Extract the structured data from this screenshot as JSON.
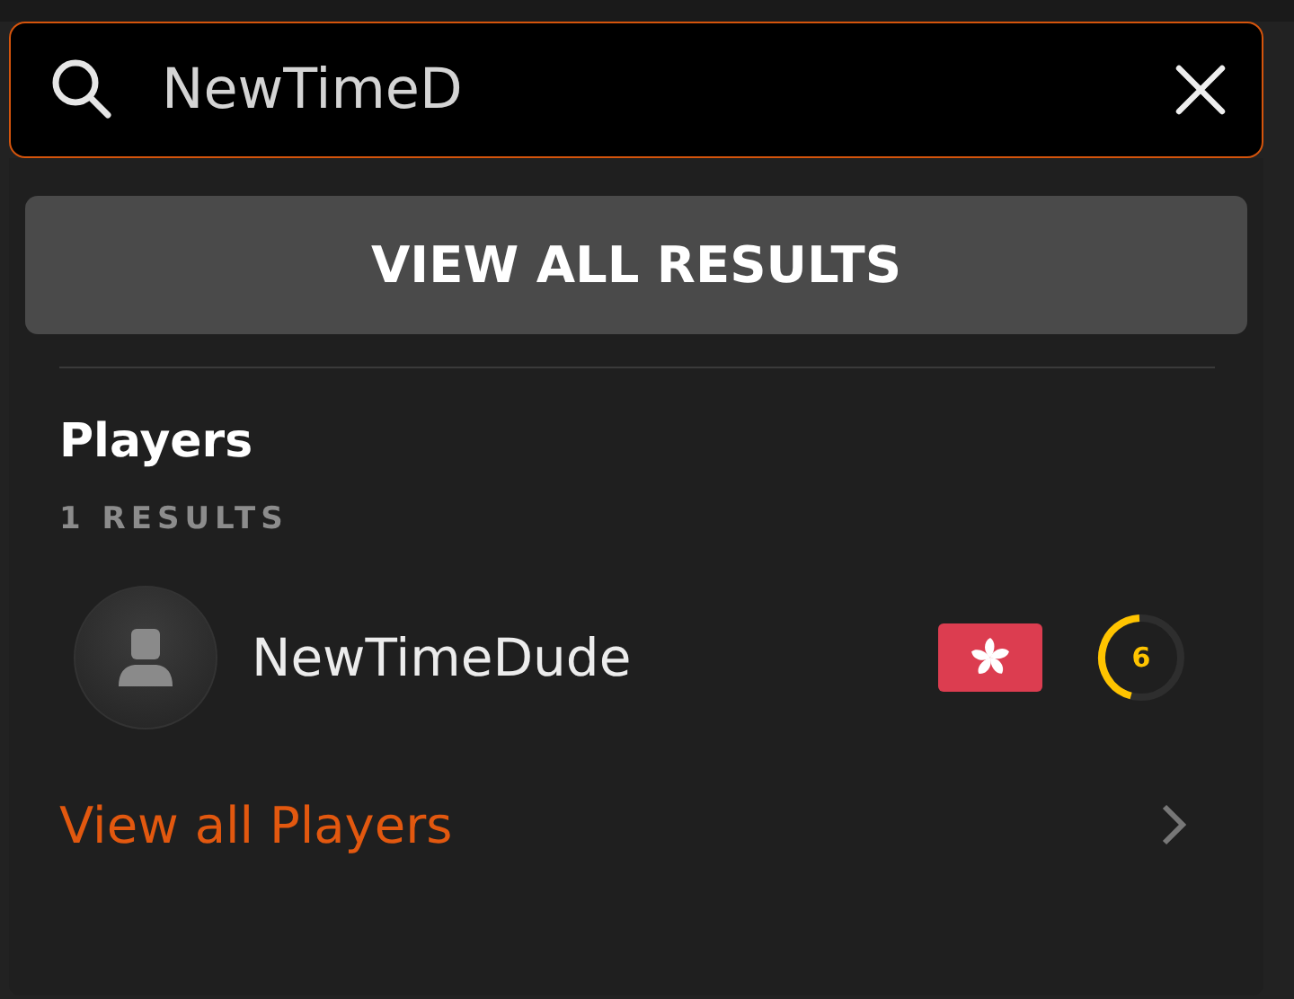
{
  "search": {
    "value": "NewTimeD"
  },
  "view_all_button": "VIEW ALL RESULTS",
  "section": {
    "title": "Players",
    "count": "1 RESULTS",
    "results": [
      {
        "name": "NewTimeDude",
        "skill_level": "6",
        "level": 0.45
      }
    ],
    "link": "View all Players"
  }
}
